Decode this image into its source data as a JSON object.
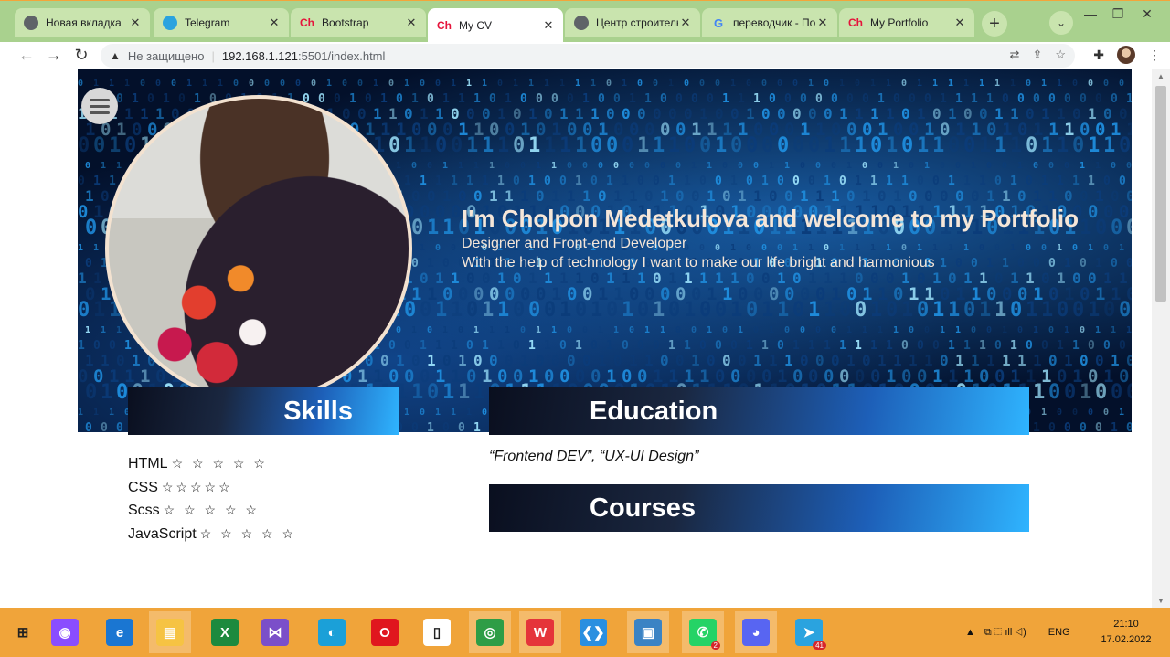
{
  "browser": {
    "tabs": [
      {
        "label": "Новая вкладка",
        "favicon": "chrome-icon",
        "color": "#5f6368",
        "active": false
      },
      {
        "label": "Telegram",
        "favicon": "telegram-icon",
        "color": "#2aa3df",
        "active": false
      },
      {
        "label": "Bootstrap",
        "favicon": "ch-icon",
        "color": "#e5143b",
        "active": false
      },
      {
        "label": "My CV",
        "favicon": "ch-icon",
        "color": "#e5143b",
        "active": true
      },
      {
        "label": "Центр строитель",
        "favicon": "globe-icon",
        "color": "#5f6368",
        "active": false
      },
      {
        "label": "переводчик - По",
        "favicon": "google-icon",
        "color": "#4285f4",
        "active": false
      },
      {
        "label": "My Portfolio",
        "favicon": "ch-icon",
        "color": "#e5143b",
        "active": false
      }
    ],
    "favicon_text": {
      "ch": "Ch",
      "google": "G"
    },
    "tab_close": "✕",
    "new_tab": "+",
    "tab_search": "⌄",
    "win_min": "—",
    "win_max": "❐",
    "win_close": "✕",
    "nav": {
      "back": "←",
      "forward": "→",
      "reload": "↻"
    },
    "address": {
      "security_icon": "▲",
      "security_text": "Не защищено",
      "separator": "|",
      "host": "192.168.1.121",
      "path": ":5501/index.html"
    },
    "omni_icons": {
      "translate": "⇄",
      "share": "⇪",
      "bookmark": "☆"
    },
    "toolbar_icons": {
      "extensions": "✚",
      "menu": "⋮"
    }
  },
  "page": {
    "hero": {
      "title": "I'm Cholpon Medetkulova and welcome to my Portfolio",
      "subtitle": "Designer and Front-end Developer",
      "tagline": "With the help of technology I want to make our life bright and harmonious"
    },
    "skills": {
      "heading": "Skills",
      "items": [
        {
          "name": "HTML",
          "stars": "☆ ☆ ☆ ☆ ☆"
        },
        {
          "name": "CSS",
          "stars": "☆☆☆☆☆"
        },
        {
          "name": "Scss",
          "stars": "☆ ☆ ☆ ☆ ☆"
        },
        {
          "name": "JavaScript",
          "stars": "☆ ☆ ☆ ☆ ☆"
        }
      ]
    },
    "education": {
      "heading": "Education",
      "text": "“Frontend DEV”, “UX-UI Design”"
    },
    "courses": {
      "heading": "Courses"
    }
  },
  "taskbar": {
    "apps": [
      {
        "name": "start-button",
        "glyph": "⊞",
        "color": "#ffffff"
      },
      {
        "name": "alice-icon",
        "glyph": "◉",
        "color": "#8a4dff"
      },
      {
        "name": "edge-legacy-icon",
        "glyph": "e",
        "color": "#1a76d2"
      },
      {
        "name": "file-explorer-icon",
        "glyph": "▤",
        "color": "#f6c343"
      },
      {
        "name": "excel-icon",
        "glyph": "X",
        "color": "#1d8a3e"
      },
      {
        "name": "visual-studio-icon",
        "glyph": "⋈",
        "color": "#7b4fc9"
      },
      {
        "name": "edge-icon",
        "glyph": "◐",
        "color": "#1ba0d8"
      },
      {
        "name": "opera-icon",
        "glyph": "O",
        "color": "#e0161e"
      },
      {
        "name": "file-icon",
        "glyph": "▯",
        "color": "#ffffff"
      },
      {
        "name": "chrome-icon",
        "glyph": "◎",
        "color": "#2e9d46"
      },
      {
        "name": "wps-icon",
        "glyph": "W",
        "color": "#e5343a"
      },
      {
        "name": "vscode-icon",
        "glyph": "❮❯",
        "color": "#2a8fe0"
      },
      {
        "name": "photos-icon",
        "glyph": "▣",
        "color": "#3b83c4"
      },
      {
        "name": "whatsapp-icon",
        "glyph": "✆",
        "color": "#25d366"
      },
      {
        "name": "discord-icon",
        "glyph": "◕",
        "color": "#5865f2"
      },
      {
        "name": "telegram-icon",
        "glyph": "➤",
        "color": "#2aa3df"
      }
    ],
    "whatsapp_badge": "2",
    "telegram_badge": "41",
    "tray": {
      "chevron": "▲",
      "icons": "⧉ ⬚ ıll ◁)",
      "lang": "ENG"
    },
    "time": "21:10",
    "date": "17.02.2022"
  },
  "colors": {
    "tab_strip": "#a9d18e",
    "taskbar": "#f0a43a",
    "hero_text": "#f5e6d8"
  }
}
